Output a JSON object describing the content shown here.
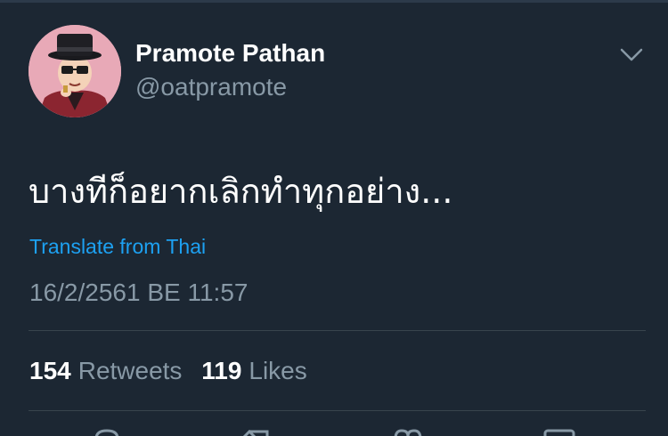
{
  "tweet": {
    "author": {
      "display_name": "Pramote Pathan",
      "handle": "@oatpramote"
    },
    "text": "บางทีก็อยากเลิกทำทุกอย่าง...",
    "translate_label": "Translate from Thai",
    "timestamp": "16/2/2561 BE 11:57",
    "stats": {
      "retweets_count": "154",
      "retweets_label": "Retweets",
      "likes_count": "119",
      "likes_label": "Likes"
    },
    "actions": [
      "reply-icon",
      "retweet-icon",
      "like-icon",
      "share-icon"
    ]
  },
  "colors": {
    "background": "#1c2733",
    "primary_text": "#ffffff",
    "secondary_text": "#8899a6",
    "link": "#1da1f2",
    "divider": "#38444d"
  }
}
